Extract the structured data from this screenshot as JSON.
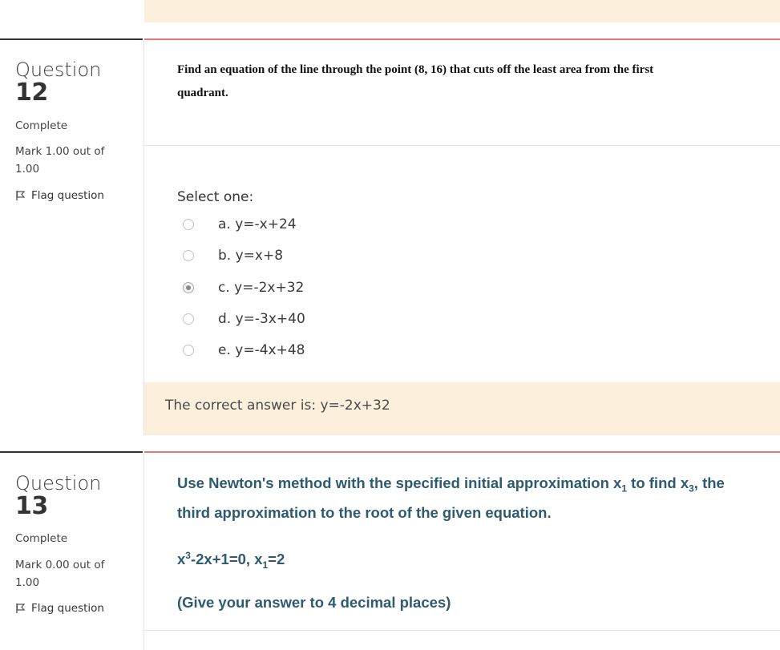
{
  "q12": {
    "label": "Question",
    "number": "12",
    "state": "Complete",
    "grade": "Mark 1.00 out of 1.00",
    "flag_label": "Flag question",
    "text_line1": "Find an equation of the line through the point (8, 16) that cuts off the least area from the first",
    "text_line2": "quadrant.",
    "select_prompt": "Select one:",
    "options": [
      {
        "label": "a. y=-x+24",
        "checked": false
      },
      {
        "label": "b. y=x+8",
        "checked": false
      },
      {
        "label": "c. y=-2x+32",
        "checked": true
      },
      {
        "label": "d. y=-3x+40",
        "checked": false
      },
      {
        "label": "e. y=-4x+48",
        "checked": false
      }
    ],
    "feedback": "The correct answer is: y=-2x+32"
  },
  "q13": {
    "label": "Question",
    "number": "13",
    "state": "Complete",
    "grade": "Mark 0.00 out of 1.00",
    "flag_label": "Flag question",
    "line1_a": "Use Newton's method with the specified initial approximation x",
    "line1_sub1": "1",
    "line1_b": " to find x",
    "line1_sub2": "3",
    "line1_c": ", the",
    "line2": "third approximation to the root of the given equation.",
    "eq_a": "x",
    "eq_sup": "3",
    "eq_b": "-2x+1=0, x",
    "eq_sub": "1",
    "eq_c": "=2",
    "note": "(Give your answer to 4 decimal places)"
  },
  "colors": {
    "feedback_bg": "#fcefdc",
    "content_rule": "#e8767a",
    "q13_text": "#2e5a72"
  },
  "icons": {
    "flag": "flag-icon",
    "radio": "radio-button"
  }
}
